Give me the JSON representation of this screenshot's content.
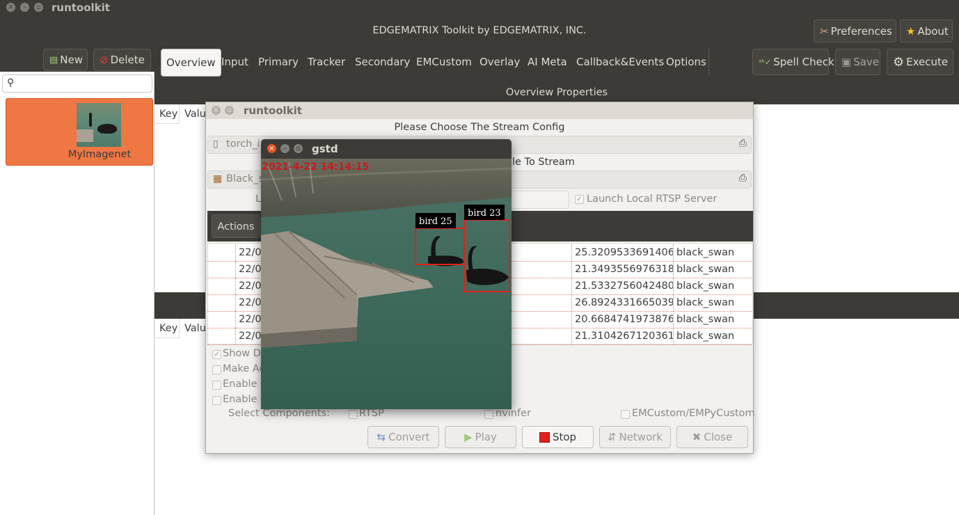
{
  "app": {
    "window_title": "runtoolkit",
    "header_title": "EDGEMATRIX Toolkit by EDGEMATRIX, INC.",
    "preferences_label": "Preferences",
    "about_label": "About"
  },
  "left_toolbar": {
    "new_label": "New",
    "delete_label": "Delete"
  },
  "sidebar": {
    "search_placeholder": "",
    "items": [
      {
        "label": "MyImagenet"
      }
    ]
  },
  "tabs": [
    {
      "label": "Overview"
    },
    {
      "label": "Input"
    },
    {
      "label": "Primary"
    },
    {
      "label": "Tracker"
    },
    {
      "label": "Secondary"
    },
    {
      "label": "EMCustom"
    },
    {
      "label": "Overlay"
    },
    {
      "label": "AI Meta"
    },
    {
      "label": "Callback&Events"
    },
    {
      "label": "Options"
    }
  ],
  "right_toolbar": {
    "spell_check_label": "Spell Check",
    "save_label": "Save",
    "execute_label": "Execute"
  },
  "main": {
    "section_title": "Overview Properties",
    "key_header": "Key",
    "value_header": "Valu",
    "key_header_2": "Key",
    "value_header_2": "Valu"
  },
  "dialog": {
    "title": "runtoolkit",
    "prompt": "Please Choose The Stream Config",
    "config_file": "torch_i",
    "source_file": "Black_s",
    "middle_label": "le To Stream",
    "l_label": "L",
    "launch_rtsp_label": "Launch Local RTSP Server",
    "launch_rtsp_checked": true,
    "actions_label": "Actions",
    "table_rows": [
      {
        "date": "22/0",
        "score": "25.320953369140625",
        "label": "black_swan"
      },
      {
        "date": "22/0",
        "score": "21.349355697631836",
        "label": "black_swan"
      },
      {
        "date": "22/0",
        "score": "21.533275604248047",
        "label": "black_swan"
      },
      {
        "date": "22/0",
        "score": "26.892433166503906",
        "label": "black_swan"
      },
      {
        "date": "22/0",
        "score": "20.668474197387695",
        "label": "black_swan"
      },
      {
        "date": "22/0",
        "score": "21.310426712036133",
        "label": "black_swan"
      }
    ],
    "options": [
      {
        "label": "Show De",
        "checked": true
      },
      {
        "label": "Make Ac",
        "checked": false
      },
      {
        "label": "Enable C",
        "checked": false
      },
      {
        "label": "Enable C",
        "checked": false
      }
    ],
    "select_components_label": "Select Components:",
    "components": [
      {
        "label": "RTSP",
        "checked": false
      },
      {
        "label": "nvinfer",
        "checked": false
      },
      {
        "label": "EMCustom/EMPyCustom",
        "checked": false
      }
    ],
    "buttons": {
      "convert": "Convert",
      "play": "Play",
      "stop": "Stop",
      "network": "Network",
      "close": "Close"
    }
  },
  "video": {
    "title": "gstd",
    "timestamp": "2021-4-22  14:14:15",
    "detections": [
      {
        "label": "bird 25"
      },
      {
        "label": "bird 23"
      }
    ]
  },
  "colors": {
    "accent": "#e95420",
    "titlebar": "#3c3b37",
    "detection_box": "#e0201c"
  }
}
